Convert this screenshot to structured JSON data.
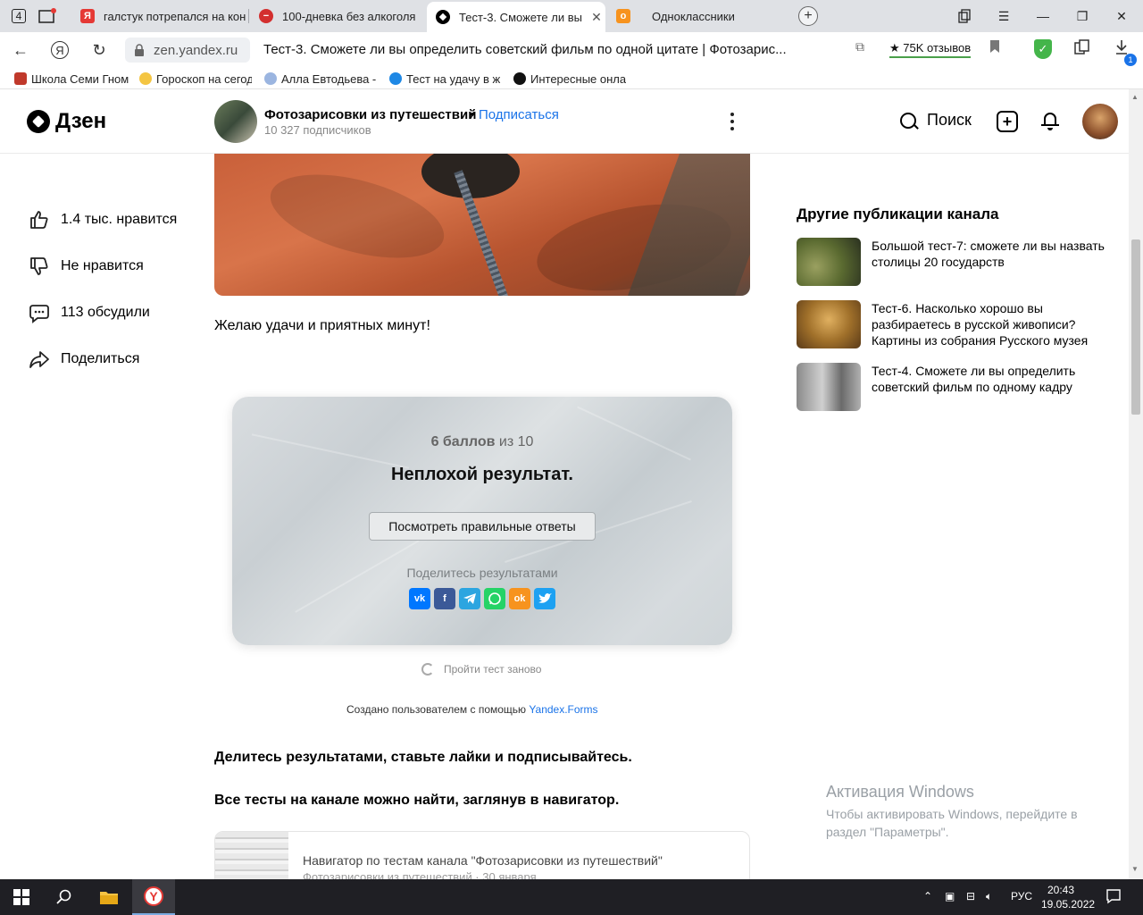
{
  "browser": {
    "tab_counter": "4",
    "tabs": [
      {
        "title": "галстук потрепался на кон",
        "favicon": "Я",
        "color": "#e53935"
      },
      {
        "title": "100-дневка без алкоголя",
        "favicon": "−",
        "color": "#d32f2f"
      },
      {
        "title": "Тест-3. Сможете ли вы",
        "favicon": "",
        "color": "#000000"
      },
      {
        "title": "Одноклассники",
        "favicon": "о",
        "color": "#f7931e"
      }
    ],
    "url": "zen.yandex.ru",
    "page_title": "Тест-3. Сможете ли вы определить советский фильм по одной цитате | Фотозарис...",
    "reviews": "★ 75K отзывов",
    "download_badge": "1",
    "bookmarks": [
      "Школа Семи Гном",
      "Гороскоп на сегод",
      "Алла Евтодьева -",
      "Тест на удачу в ж",
      "Интересные онла"
    ]
  },
  "zen": {
    "logo": "Дзен",
    "channel_name": "Фотозарисовки из путешествий",
    "dot": "•",
    "subscribe": "Подписаться",
    "subscribers": "10 327 подписчиков",
    "search": "Поиск"
  },
  "actions": {
    "likes": "1.4 тыс. нравится",
    "dislike": "Не нравится",
    "comments": "113 обсудили",
    "share": "Поделиться"
  },
  "article": {
    "wish": "Желаю удачи и приятных минут!",
    "quiz": {
      "score_strong": "6 баллов",
      "score_rest": " из 10",
      "result": "Неплохой результат.",
      "answers_button": "Посмотреть правильные ответы",
      "share_label": "Поделитесь результатами",
      "share_buttons": [
        "vk",
        "f",
        "tg",
        "wa",
        "ok",
        "tw"
      ]
    },
    "retry": "Пройти тест заново",
    "created_prefix": "Создано пользователем с помощью ",
    "created_link": "Yandex.Forms",
    "share_line": "Делитесь результатами, ставьте лайки и подписывайтесь.",
    "navigator_line": "Все тесты на канале можно найти, заглянув в навигатор.",
    "nav_card": {
      "title": "Навигатор по тестам канала \"Фотозарисовки из путешествий\"",
      "meta": "Фотозарисовки из путешествий · 30 января"
    }
  },
  "sidebar": {
    "title": "Другие публикации канала",
    "items": [
      {
        "text": "Большой тест-7: сможете ли вы назвать столицы 20 государств"
      },
      {
        "text": "Тест-6. Насколько хорошо вы разбираетесь в русской живописи? Картины из собрания Русского музея"
      },
      {
        "text": "Тест-4. Сможете ли вы определить советский фильм по одному кадру"
      }
    ]
  },
  "windows": {
    "activate_title": "Активация Windows",
    "activate_text": "Чтобы активировать Windows, перейдите в раздел \"Параметры\".",
    "lang": "РУС",
    "time": "20:43",
    "date": "19.05.2022"
  }
}
